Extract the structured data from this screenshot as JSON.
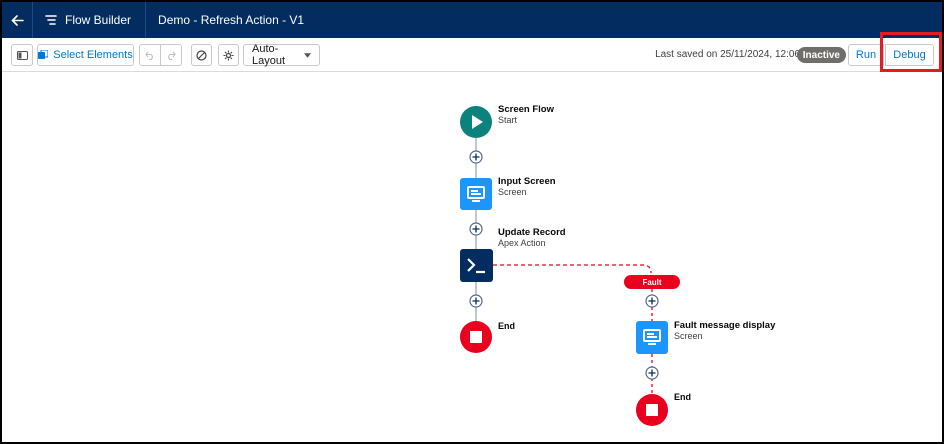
{
  "header": {
    "app_name": "Flow Builder",
    "flow_title": "Demo - Refresh Action - V1",
    "bg_color": "#032d60"
  },
  "toolbar": {
    "select_elements": "Select Elements",
    "layout_mode": "Auto-Layout",
    "last_saved": "Last saved on 25/11/2024, 12:06",
    "status_badge": "Inactive",
    "run_label": "Run",
    "debug_label": "Debug"
  },
  "canvas": {
    "start": {
      "title": "Screen Flow",
      "subtitle": "Start",
      "color": "#0b827c"
    },
    "input_screen": {
      "title": "Input Screen",
      "subtitle": "Screen",
      "color": "#1b96ff"
    },
    "update_record": {
      "title": "Update Record",
      "subtitle": "Apex Action",
      "color": "#032d60"
    },
    "end_main": {
      "title": "End",
      "color": "#ea001e"
    },
    "fault_label": "Fault",
    "fault_screen": {
      "title": "Fault message display",
      "subtitle": "Screen",
      "color": "#1b96ff"
    },
    "end_fault": {
      "title": "End",
      "color": "#ea001e"
    }
  }
}
